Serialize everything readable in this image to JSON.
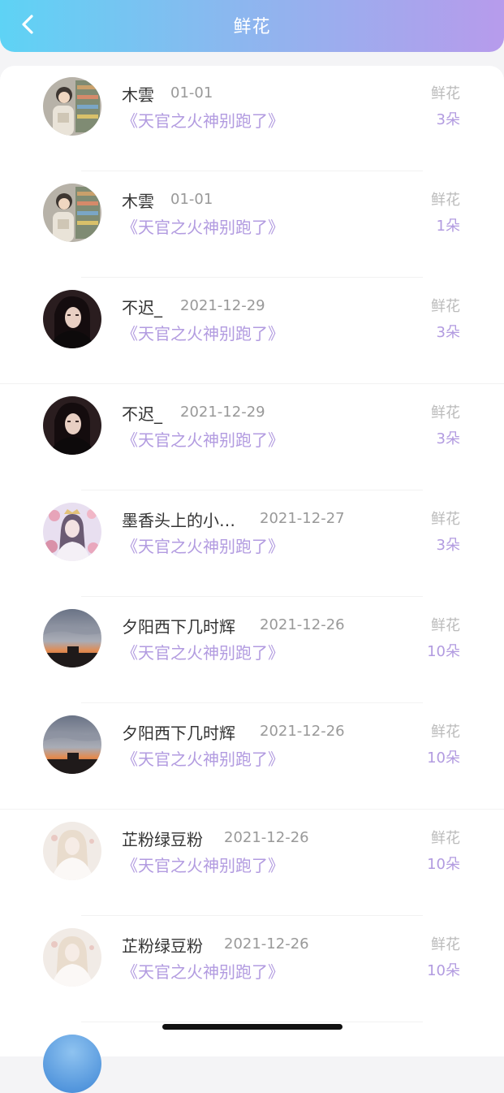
{
  "header": {
    "title": "鲜花",
    "back_icon": "chevron-left-icon",
    "gradient": [
      "#5ed3f5",
      "#b79bec"
    ]
  },
  "colors": {
    "accent": "#b29be0",
    "name": "#333333",
    "muted": "#999999"
  },
  "records": [
    {
      "name": "木雲",
      "date": "01-01",
      "book": "《天官之火神别跑了》",
      "gift_label": "鲜花",
      "count": "3朵",
      "avatar": "avatar-girl-store"
    },
    {
      "name": "木雲",
      "date": "01-01",
      "book": "《天官之火神别跑了》",
      "gift_label": "鲜花",
      "count": "1朵",
      "avatar": "avatar-girl-store"
    },
    {
      "name": "不迟_",
      "date": "2021-12-29",
      "book": "《天官之火神别跑了》",
      "gift_label": "鲜花",
      "count": "3朵",
      "avatar": "avatar-dark-portrait"
    },
    {
      "name": "不迟_",
      "date": "2021-12-29",
      "book": "《天官之火神别跑了》",
      "gift_label": "鲜花",
      "count": "3朵",
      "avatar": "avatar-dark-portrait"
    },
    {
      "name": "墨香头上的小…",
      "date": "2021-12-27",
      "book": "《天官之火神别跑了》",
      "gift_label": "鲜花",
      "count": "3朵",
      "avatar": "avatar-pink-flowers"
    },
    {
      "name": "夕阳西下几时辉",
      "date": "2021-12-26",
      "book": "《天官之火神别跑了》",
      "gift_label": "鲜花",
      "count": "10朵",
      "avatar": "avatar-sunset"
    },
    {
      "name": "夕阳西下几时辉",
      "date": "2021-12-26",
      "book": "《天官之火神别跑了》",
      "gift_label": "鲜花",
      "count": "10朵",
      "avatar": "avatar-sunset"
    },
    {
      "name": "芷粉绿豆粉",
      "date": "2021-12-26",
      "book": "《天官之火神别跑了》",
      "gift_label": "鲜花",
      "count": "10朵",
      "avatar": "avatar-white-dress"
    },
    {
      "name": "芷粉绿豆粉",
      "date": "2021-12-26",
      "book": "《天官之火神别跑了》",
      "gift_label": "鲜花",
      "count": "10朵",
      "avatar": "avatar-white-dress"
    }
  ]
}
